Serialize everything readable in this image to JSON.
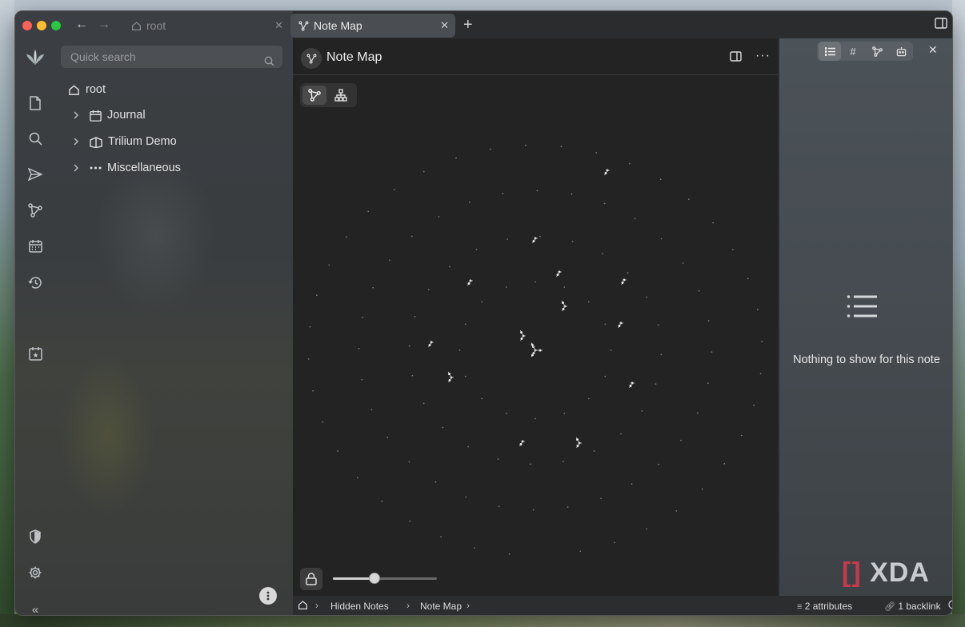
{
  "tabs": [
    {
      "label": "root"
    },
    {
      "label": "Note Map"
    }
  ],
  "sidebar": {
    "search_placeholder": "Quick search",
    "tree": {
      "root": "root",
      "items": [
        {
          "label": "Journal"
        },
        {
          "label": "Trilium Demo"
        },
        {
          "label": "Miscellaneous"
        }
      ]
    }
  },
  "main": {
    "title": "Note Map",
    "zoom_level": 0.4
  },
  "right_panel": {
    "empty_message": "Nothing to show for this note"
  },
  "status": {
    "breadcrumb": [
      "Hidden Notes",
      "Note Map"
    ],
    "attributes": "2 attributes",
    "backlinks": "1 backlink"
  },
  "watermark": "XDA"
}
